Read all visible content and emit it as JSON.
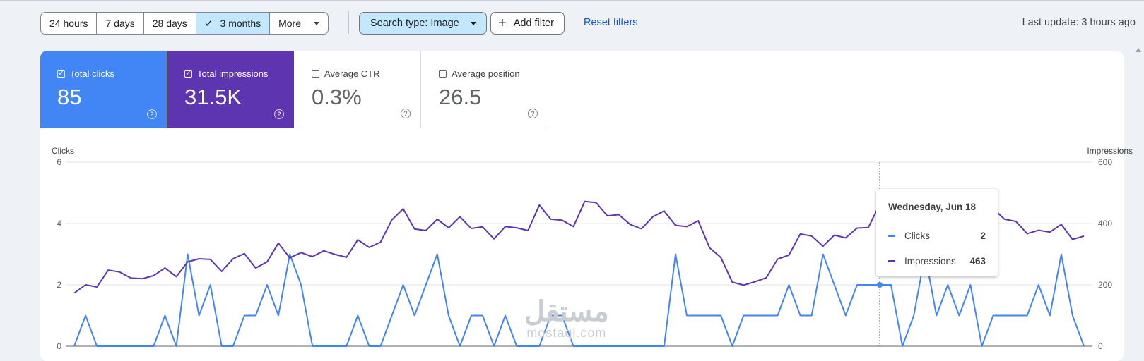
{
  "toolbar": {
    "ranges": [
      "24 hours",
      "7 days",
      "28 days",
      "3 months"
    ],
    "selected_range": "3 months",
    "more_label": "More",
    "search_type_label": "Search type: Image",
    "add_filter_label": "Add filter",
    "reset_filters_label": "Reset filters",
    "last_update": "Last update: 3 hours ago"
  },
  "metrics": [
    {
      "label": "Total clicks",
      "value": "85",
      "checked": true,
      "color": "#4285f4"
    },
    {
      "label": "Total impressions",
      "value": "31.5K",
      "checked": true,
      "color": "#5e35b1"
    },
    {
      "label": "Average CTR",
      "value": "0.3%",
      "checked": false
    },
    {
      "label": "Average position",
      "value": "26.5",
      "checked": false
    }
  ],
  "tooltip": {
    "date": "Wednesday, Jun 18",
    "rows": [
      {
        "label": "Clicks",
        "value": "2",
        "color": "#4285f4"
      },
      {
        "label": "Impressions",
        "value": "463",
        "color": "#5e35b1"
      }
    ]
  },
  "watermark": {
    "arabic": "مستقل",
    "latin": "mostaql.com"
  },
  "chart_data": {
    "type": "line",
    "left_axis": {
      "label": "Clicks",
      "ticks": [
        "0",
        "2",
        "4",
        "6"
      ],
      "range": [
        0,
        6
      ]
    },
    "right_axis": {
      "label": "Impressions",
      "ticks": [
        "0",
        "200",
        "400",
        "600"
      ],
      "range": [
        0,
        600
      ]
    },
    "grid": true,
    "highlight_index": 71,
    "series": [
      {
        "name": "Clicks",
        "axis": "left",
        "color": "#4285f4",
        "values": [
          0,
          1,
          0,
          0,
          0,
          0,
          0,
          0,
          1,
          0,
          3,
          1,
          2,
          0,
          0,
          1,
          1,
          2,
          1,
          3,
          2,
          0,
          0,
          0,
          0,
          1,
          0,
          0,
          1,
          2,
          1,
          2,
          3,
          1,
          0,
          1,
          1,
          0,
          1,
          0,
          0,
          0,
          1,
          1,
          0,
          0,
          0,
          0,
          0,
          0,
          0,
          0,
          0,
          3,
          1,
          1,
          1,
          1,
          0,
          1,
          1,
          1,
          1,
          2,
          1,
          1,
          3,
          2,
          1,
          2,
          2,
          2,
          2,
          0,
          1,
          3,
          1,
          2,
          1,
          2,
          0,
          1,
          1,
          1,
          1,
          2,
          1,
          3,
          1,
          0
        ]
      },
      {
        "name": "Impressions",
        "axis": "right",
        "color": "#5e35b1",
        "values": [
          173,
          200,
          193,
          248,
          242,
          222,
          220,
          230,
          255,
          227,
          275,
          285,
          283,
          244,
          285,
          302,
          255,
          275,
          336,
          288,
          305,
          292,
          311,
          299,
          290,
          347,
          322,
          339,
          412,
          448,
          382,
          377,
          414,
          386,
          422,
          384,
          389,
          350,
          390,
          386,
          377,
          460,
          414,
          411,
          390,
          472,
          468,
          425,
          429,
          397,
          383,
          422,
          441,
          394,
          390,
          409,
          321,
          289,
          209,
          199,
          210,
          223,
          284,
          297,
          366,
          359,
          326,
          362,
          353,
          385,
          387,
          463,
          418,
          385,
          421,
          370,
          380,
          365,
          369,
          410,
          447,
          448,
          414,
          407,
          367,
          378,
          372,
          397,
          348,
          359
        ]
      }
    ]
  }
}
